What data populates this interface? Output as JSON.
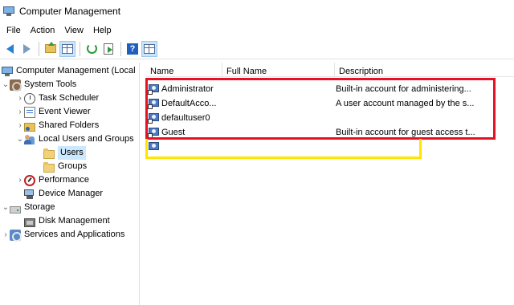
{
  "window": {
    "title": "Computer Management"
  },
  "menu": [
    "File",
    "Action",
    "View",
    "Help"
  ],
  "toolbar": {
    "icons": [
      "back-arrow-icon",
      "forward-arrow-icon",
      "up-folder-icon",
      "show-hide-tree-icon",
      "refresh-icon",
      "export-list-icon",
      "help-icon",
      "properties-icon"
    ],
    "help_glyph": "?"
  },
  "tree": {
    "root": "Computer Management (Local",
    "system_tools": "System Tools",
    "task_scheduler": "Task Scheduler",
    "event_viewer": "Event Viewer",
    "shared_folders": "Shared Folders",
    "local_users_groups": "Local Users and Groups",
    "users": "Users",
    "groups": "Groups",
    "performance": "Performance",
    "device_manager": "Device Manager",
    "storage": "Storage",
    "disk_management": "Disk Management",
    "services_apps": "Services and Applications",
    "chevron_expanded": "⌄",
    "chevron_collapsed": "›"
  },
  "list": {
    "columns": [
      "Name",
      "Full Name",
      "Description"
    ],
    "rows": [
      {
        "name": "Administrator",
        "full_name": "",
        "description": "Built-in account for administering..."
      },
      {
        "name": "DefaultAcco...",
        "full_name": "",
        "description": "A user account managed by the s..."
      },
      {
        "name": "defaultuser0",
        "full_name": "",
        "description": ""
      },
      {
        "name": "Guest",
        "full_name": "",
        "description": "Built-in account for guest access t..."
      },
      {
        "name": "",
        "full_name": "",
        "description": ""
      }
    ]
  },
  "colors": {
    "highlight_red": "#e81123",
    "highlight_yellow": "#ffe600",
    "selection": "#cce8ff"
  }
}
